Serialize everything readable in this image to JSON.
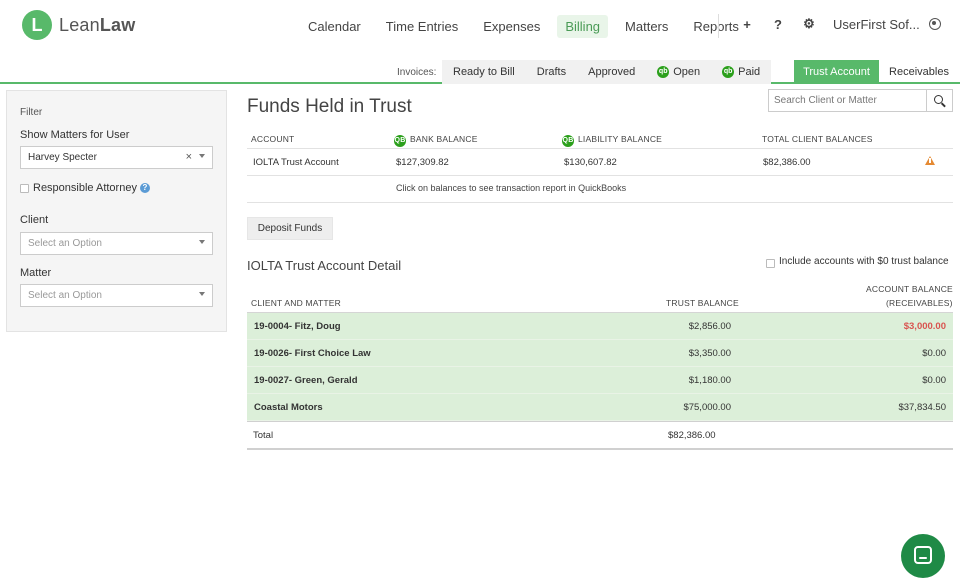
{
  "brand": {
    "initial": "L",
    "name_light": "Lean",
    "name_bold": "Law",
    "color": "#58b96a"
  },
  "nav": {
    "items": [
      {
        "label": "Calendar"
      },
      {
        "label": "Time Entries"
      },
      {
        "label": "Expenses"
      },
      {
        "label": "Billing",
        "active": true
      },
      {
        "label": "Matters"
      },
      {
        "label": "Reports"
      }
    ],
    "add_icon": "+",
    "help_icon": "?",
    "settings_icon": "⚙",
    "user_name": "UserFirst Sof..."
  },
  "subnav": {
    "invoices_label": "Invoices:",
    "tabs": [
      {
        "label": "Ready to Bill",
        "qb": false
      },
      {
        "label": "Drafts",
        "qb": false
      },
      {
        "label": "Approved",
        "qb": false
      },
      {
        "label": "Open",
        "qb": true
      },
      {
        "label": "Paid",
        "qb": true
      }
    ],
    "qb_glyph": "qb",
    "trust_tab": "Trust Account",
    "receivables_tab": "Receivables"
  },
  "filter": {
    "title": "Filter",
    "show_matters_label": "Show Matters for User",
    "user_value": "Harvey Specter",
    "clear_glyph": "×",
    "responsible_label": "Responsible Attorney",
    "help_glyph": "?",
    "client_label": "Client",
    "client_placeholder": "Select an Option",
    "matter_label": "Matter",
    "matter_placeholder": "Select an Option"
  },
  "main": {
    "title": "Funds Held in Trust",
    "search_placeholder": "Search Client or Matter",
    "summary": {
      "headers": {
        "account": "ACCOUNT",
        "bank": "BANK BALANCE",
        "liability": "LIABILITY BALANCE",
        "total": "TOTAL CLIENT BALANCES"
      },
      "row": {
        "account": "IOLTA Trust Account",
        "bank": "$127,309.82",
        "liability": "$130,607.82",
        "total": "$82,386.00"
      },
      "note": "Click on balances to see transaction report in QuickBooks"
    },
    "deposit_button": "Deposit Funds",
    "detail_title": "IOLTA Trust Account Detail",
    "include_zero_label": "Include accounts with $0 trust balance",
    "detail_headers": {
      "client": "CLIENT AND MATTER",
      "trust": "TRUST BALANCE",
      "account_line1": "ACCOUNT BALANCE",
      "account_line2": "(RECEIVABLES)"
    },
    "detail_rows": [
      {
        "client": "19-0004- Fitz, Doug",
        "trust": "$2,856.00",
        "account": "$3,000.00",
        "negative": true
      },
      {
        "client": "19-0026- First Choice Law",
        "trust": "$3,350.00",
        "account": "$0.00",
        "negative": false
      },
      {
        "client": "19-0027- Green, Gerald",
        "trust": "$1,180.00",
        "account": "$0.00",
        "negative": false
      },
      {
        "client": "Coastal Motors",
        "trust": "$75,000.00",
        "account": "$37,834.50",
        "negative": false
      }
    ],
    "total_label": "Total",
    "total_trust": "$82,386.00"
  }
}
